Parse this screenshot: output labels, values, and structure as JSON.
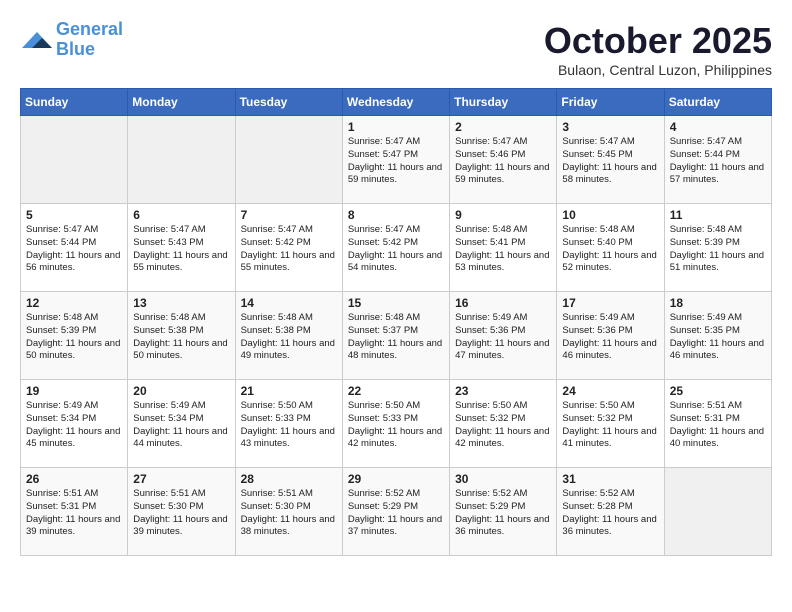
{
  "header": {
    "logo_line1": "General",
    "logo_line2": "Blue",
    "month": "October 2025",
    "location": "Bulaon, Central Luzon, Philippines"
  },
  "weekdays": [
    "Sunday",
    "Monday",
    "Tuesday",
    "Wednesday",
    "Thursday",
    "Friday",
    "Saturday"
  ],
  "weeks": [
    [
      {
        "day": "",
        "info": ""
      },
      {
        "day": "",
        "info": ""
      },
      {
        "day": "",
        "info": ""
      },
      {
        "day": "1",
        "info": "Sunrise: 5:47 AM\nSunset: 5:47 PM\nDaylight: 11 hours and 59 minutes."
      },
      {
        "day": "2",
        "info": "Sunrise: 5:47 AM\nSunset: 5:46 PM\nDaylight: 11 hours and 59 minutes."
      },
      {
        "day": "3",
        "info": "Sunrise: 5:47 AM\nSunset: 5:45 PM\nDaylight: 11 hours and 58 minutes."
      },
      {
        "day": "4",
        "info": "Sunrise: 5:47 AM\nSunset: 5:44 PM\nDaylight: 11 hours and 57 minutes."
      }
    ],
    [
      {
        "day": "5",
        "info": "Sunrise: 5:47 AM\nSunset: 5:44 PM\nDaylight: 11 hours and 56 minutes."
      },
      {
        "day": "6",
        "info": "Sunrise: 5:47 AM\nSunset: 5:43 PM\nDaylight: 11 hours and 55 minutes."
      },
      {
        "day": "7",
        "info": "Sunrise: 5:47 AM\nSunset: 5:42 PM\nDaylight: 11 hours and 55 minutes."
      },
      {
        "day": "8",
        "info": "Sunrise: 5:47 AM\nSunset: 5:42 PM\nDaylight: 11 hours and 54 minutes."
      },
      {
        "day": "9",
        "info": "Sunrise: 5:48 AM\nSunset: 5:41 PM\nDaylight: 11 hours and 53 minutes."
      },
      {
        "day": "10",
        "info": "Sunrise: 5:48 AM\nSunset: 5:40 PM\nDaylight: 11 hours and 52 minutes."
      },
      {
        "day": "11",
        "info": "Sunrise: 5:48 AM\nSunset: 5:39 PM\nDaylight: 11 hours and 51 minutes."
      }
    ],
    [
      {
        "day": "12",
        "info": "Sunrise: 5:48 AM\nSunset: 5:39 PM\nDaylight: 11 hours and 50 minutes."
      },
      {
        "day": "13",
        "info": "Sunrise: 5:48 AM\nSunset: 5:38 PM\nDaylight: 11 hours and 50 minutes."
      },
      {
        "day": "14",
        "info": "Sunrise: 5:48 AM\nSunset: 5:38 PM\nDaylight: 11 hours and 49 minutes."
      },
      {
        "day": "15",
        "info": "Sunrise: 5:48 AM\nSunset: 5:37 PM\nDaylight: 11 hours and 48 minutes."
      },
      {
        "day": "16",
        "info": "Sunrise: 5:49 AM\nSunset: 5:36 PM\nDaylight: 11 hours and 47 minutes."
      },
      {
        "day": "17",
        "info": "Sunrise: 5:49 AM\nSunset: 5:36 PM\nDaylight: 11 hours and 46 minutes."
      },
      {
        "day": "18",
        "info": "Sunrise: 5:49 AM\nSunset: 5:35 PM\nDaylight: 11 hours and 46 minutes."
      }
    ],
    [
      {
        "day": "19",
        "info": "Sunrise: 5:49 AM\nSunset: 5:34 PM\nDaylight: 11 hours and 45 minutes."
      },
      {
        "day": "20",
        "info": "Sunrise: 5:49 AM\nSunset: 5:34 PM\nDaylight: 11 hours and 44 minutes."
      },
      {
        "day": "21",
        "info": "Sunrise: 5:50 AM\nSunset: 5:33 PM\nDaylight: 11 hours and 43 minutes."
      },
      {
        "day": "22",
        "info": "Sunrise: 5:50 AM\nSunset: 5:33 PM\nDaylight: 11 hours and 42 minutes."
      },
      {
        "day": "23",
        "info": "Sunrise: 5:50 AM\nSunset: 5:32 PM\nDaylight: 11 hours and 42 minutes."
      },
      {
        "day": "24",
        "info": "Sunrise: 5:50 AM\nSunset: 5:32 PM\nDaylight: 11 hours and 41 minutes."
      },
      {
        "day": "25",
        "info": "Sunrise: 5:51 AM\nSunset: 5:31 PM\nDaylight: 11 hours and 40 minutes."
      }
    ],
    [
      {
        "day": "26",
        "info": "Sunrise: 5:51 AM\nSunset: 5:31 PM\nDaylight: 11 hours and 39 minutes."
      },
      {
        "day": "27",
        "info": "Sunrise: 5:51 AM\nSunset: 5:30 PM\nDaylight: 11 hours and 39 minutes."
      },
      {
        "day": "28",
        "info": "Sunrise: 5:51 AM\nSunset: 5:30 PM\nDaylight: 11 hours and 38 minutes."
      },
      {
        "day": "29",
        "info": "Sunrise: 5:52 AM\nSunset: 5:29 PM\nDaylight: 11 hours and 37 minutes."
      },
      {
        "day": "30",
        "info": "Sunrise: 5:52 AM\nSunset: 5:29 PM\nDaylight: 11 hours and 36 minutes."
      },
      {
        "day": "31",
        "info": "Sunrise: 5:52 AM\nSunset: 5:28 PM\nDaylight: 11 hours and 36 minutes."
      },
      {
        "day": "",
        "info": ""
      }
    ]
  ]
}
